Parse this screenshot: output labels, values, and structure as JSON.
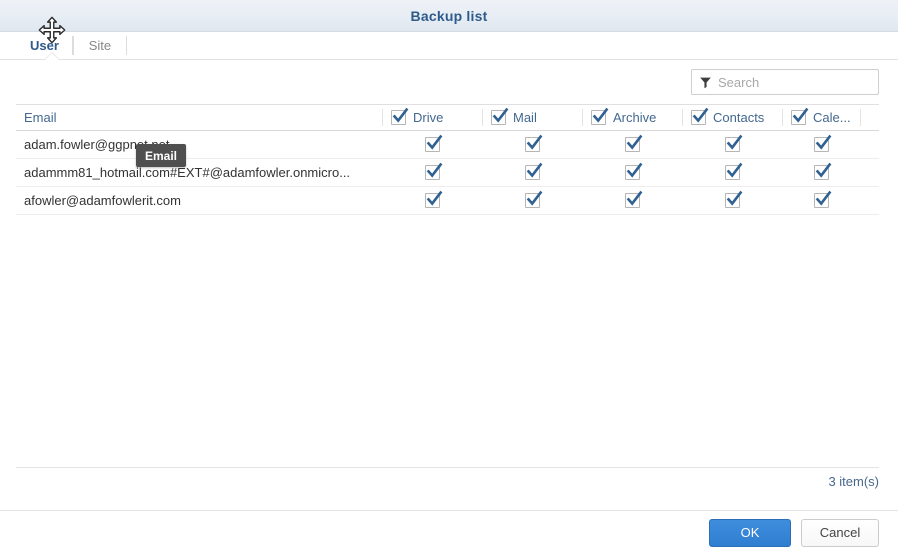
{
  "window": {
    "title": "Backup list"
  },
  "tabs": [
    {
      "label": "User",
      "active": true
    },
    {
      "label": "Site",
      "active": false
    }
  ],
  "search": {
    "placeholder": "Search",
    "value": "",
    "icon": "funnel-filter-icon"
  },
  "table": {
    "columns": [
      {
        "key": "email",
        "label": "Email",
        "checkbox": false
      },
      {
        "key": "drive",
        "label": "Drive",
        "checkbox": true,
        "checked": true
      },
      {
        "key": "mail",
        "label": "Mail",
        "checkbox": true,
        "checked": true
      },
      {
        "key": "archive",
        "label": "Archive",
        "checkbox": true,
        "checked": true
      },
      {
        "key": "contacts",
        "label": "Contacts",
        "checkbox": true,
        "checked": true
      },
      {
        "key": "calendar",
        "label": "Cale...",
        "checkbox": true,
        "checked": true
      }
    ],
    "rows": [
      {
        "email": "adam.fowler@ggpnet.net",
        "drive": true,
        "mail": true,
        "archive": true,
        "contacts": true,
        "calendar": true
      },
      {
        "email": "adammm81_hotmail.com#EXT#@adamfowler.onmicro...",
        "drive": true,
        "mail": true,
        "archive": true,
        "contacts": true,
        "calendar": true
      },
      {
        "email": "afowler@adamfowlerit.com",
        "drive": true,
        "mail": true,
        "archive": true,
        "contacts": true,
        "calendar": true
      }
    ],
    "count_label": "3 item(s)"
  },
  "tooltip": {
    "text": "Email"
  },
  "cursor": {
    "type": "move-cursor"
  },
  "footer": {
    "ok_label": "OK",
    "cancel_label": "Cancel"
  },
  "colors": {
    "title_blue": "#2f5b8b",
    "header_text": "#43688f",
    "accent_blue": "#2f7ed0",
    "check_blue": "#2f6193",
    "count_text": "#49688c",
    "tooltip_bg": "#4f4f4f"
  }
}
